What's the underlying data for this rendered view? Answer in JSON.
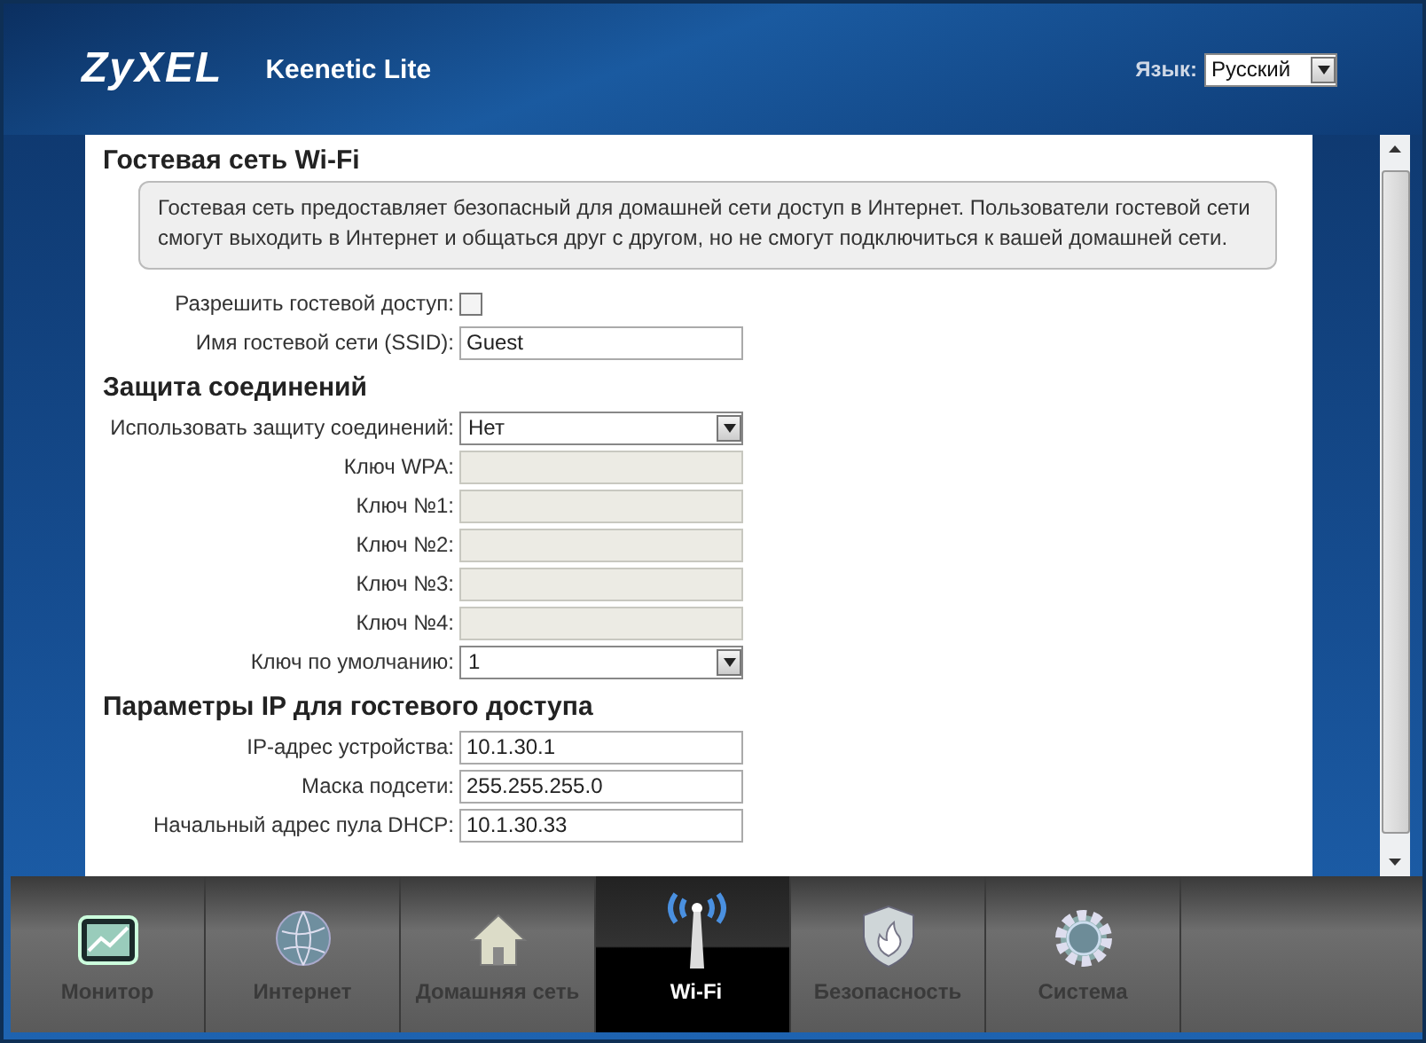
{
  "header": {
    "logo": "ZyXEL",
    "model": "Keenetic Lite",
    "language_label": "Язык:",
    "language_value": "Русский"
  },
  "sections": [
    {
      "title": "Гостевая сеть Wi-Fi",
      "info": "Гостевая сеть предоставляет безопасный для домашней сети доступ в Интернет. Пользователи гостевой сети смогут выходить в Интернет и общаться друг с другом, но не смогут подключиться к вашей домашней сети.",
      "rows": [
        {
          "kind": "checkbox",
          "label": "Разрешить гостевой доступ:",
          "checked": false
        },
        {
          "kind": "text",
          "label": "Имя гостевой сети (SSID):",
          "value": "Guest"
        }
      ]
    },
    {
      "title": "Защита соединений",
      "rows": [
        {
          "kind": "select",
          "label": "Использовать защиту соединений:",
          "value": "Нет"
        },
        {
          "kind": "disabled",
          "label": "Ключ WPA:"
        },
        {
          "kind": "disabled",
          "label": "Ключ №1:"
        },
        {
          "kind": "disabled",
          "label": "Ключ №2:"
        },
        {
          "kind": "disabled",
          "label": "Ключ №3:"
        },
        {
          "kind": "disabled",
          "label": "Ключ №4:"
        },
        {
          "kind": "select",
          "label": "Ключ по умолчанию:",
          "value": "1"
        }
      ]
    },
    {
      "title": "Параметры IP для гостевого доступа",
      "rows": [
        {
          "kind": "text",
          "label": "IP-адрес устройства:",
          "value": "10.1.30.1"
        },
        {
          "kind": "text",
          "label": "Маска подсети:",
          "value": "255.255.255.0"
        },
        {
          "kind": "text",
          "label": "Начальный адрес пула DHCP:",
          "value": "10.1.30.33"
        }
      ]
    }
  ],
  "nav": [
    {
      "kind": "monitor",
      "label": "Монитор",
      "selected": false
    },
    {
      "kind": "globe",
      "label": "Интернет",
      "selected": false
    },
    {
      "kind": "house",
      "label": "Домашняя сеть",
      "selected": false
    },
    {
      "kind": "antenna",
      "label": "Wi-Fi",
      "selected": true
    },
    {
      "kind": "shield",
      "label": "Безопасность",
      "selected": false
    },
    {
      "kind": "gear",
      "label": "Система",
      "selected": false
    }
  ]
}
